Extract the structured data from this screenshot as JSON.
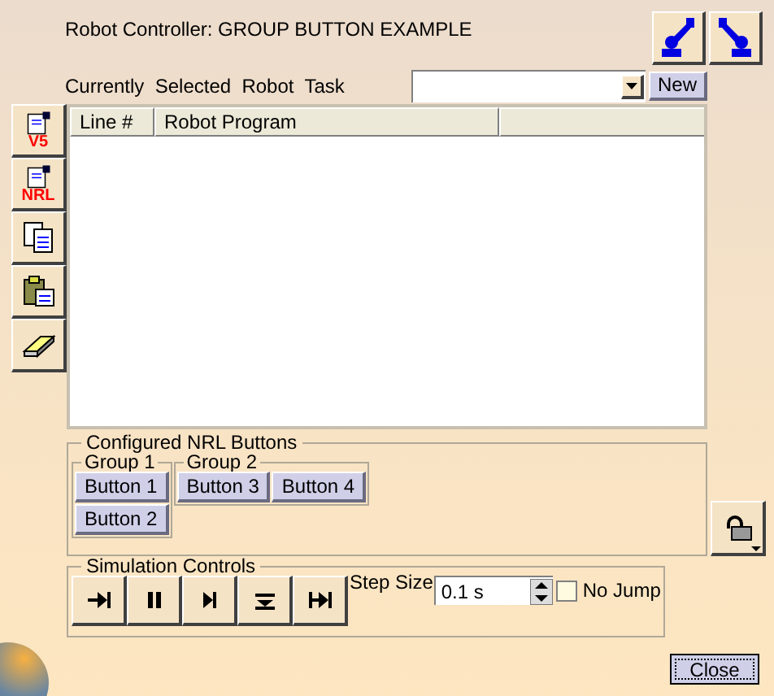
{
  "window": {
    "title": "Robot Controller: GROUP BUTTON EXAMPLE"
  },
  "task": {
    "label": "Currently  Selected  Robot  Task",
    "new_button": "New"
  },
  "toolbar": [
    {
      "kind": "doc",
      "badge": "V5"
    },
    {
      "kind": "doc",
      "badge": "NRL"
    },
    {
      "kind": "copy"
    },
    {
      "kind": "paste"
    },
    {
      "kind": "eraser"
    }
  ],
  "table": {
    "columns": [
      "Line #",
      "Robot Program"
    ]
  },
  "nrl_buttons": {
    "title": "Configured NRL Buttons",
    "groups": [
      {
        "title": "Group 1",
        "buttons": [
          "Button 1",
          "Button 2"
        ]
      },
      {
        "title": "Group 2",
        "buttons": [
          "Button 3",
          "Button 4"
        ]
      }
    ]
  },
  "simulation": {
    "title": "Simulation Controls",
    "controls": [
      {
        "kind": "step-in"
      },
      {
        "kind": "pause"
      },
      {
        "kind": "play-step"
      },
      {
        "kind": "step-down"
      },
      {
        "kind": "jump-end"
      }
    ],
    "step_size_label": "Step Size",
    "step_size": "0.1 s",
    "no_jump": {
      "label": "No Jump",
      "checked": false
    }
  },
  "close_button": "Close"
}
